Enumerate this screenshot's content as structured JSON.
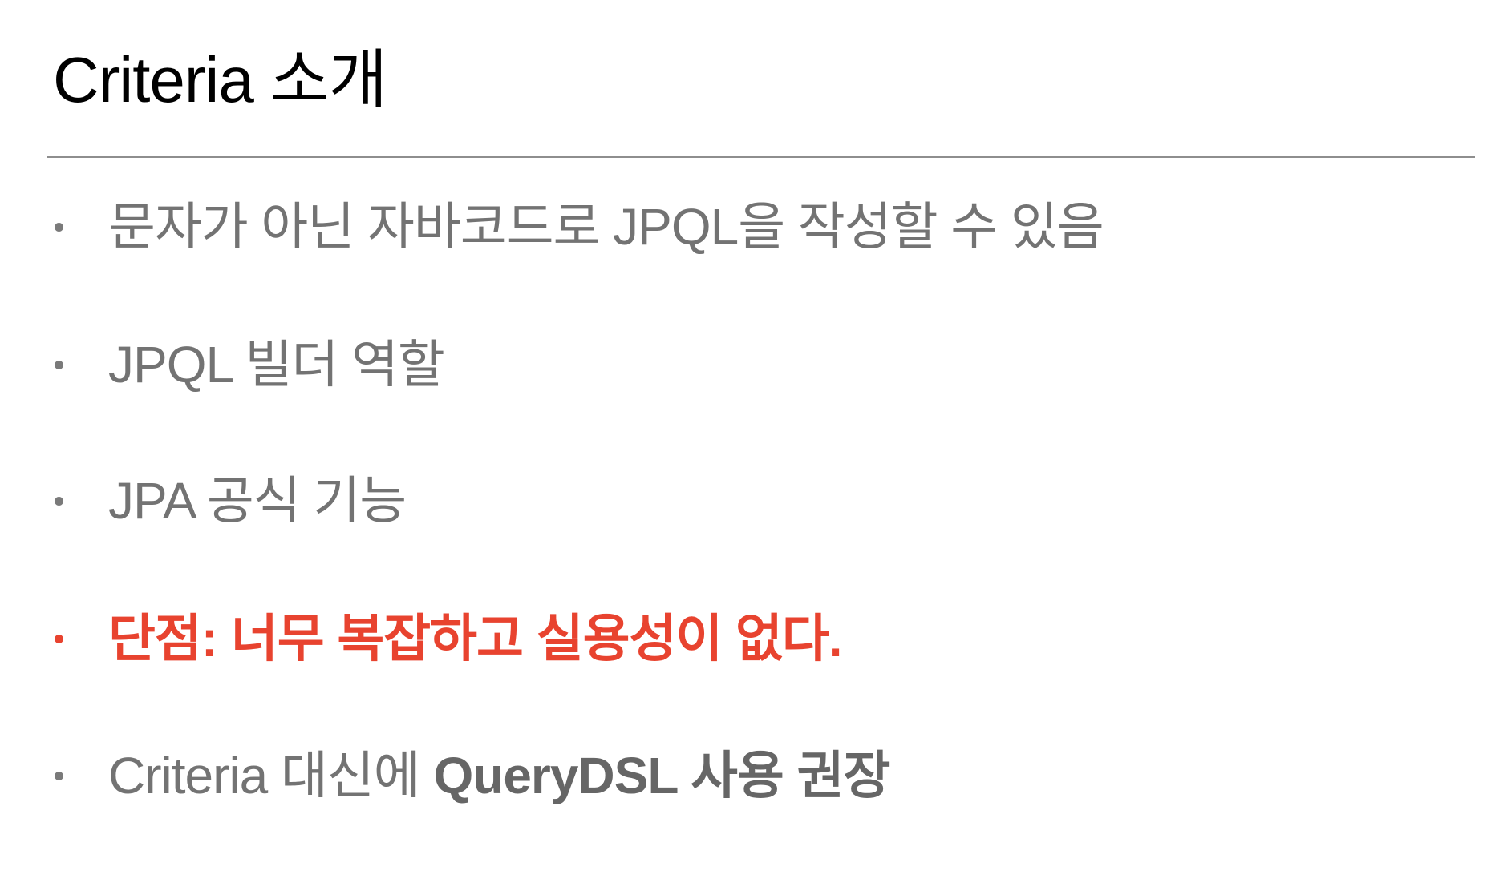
{
  "slide": {
    "title": "Criteria 소개"
  },
  "bullets": [
    {
      "text": "문자가 아닌 자바코드로 JPQL을 작성할 수 있음"
    },
    {
      "text": "JPQL 빌더 역할"
    },
    {
      "text": "JPA 공식 기능"
    },
    {
      "text": "단점: 너무 복잡하고 실용성이 없다."
    },
    {
      "text_prefix": "Criteria 대신에 ",
      "text_bold": "QueryDSL 사용 권장"
    }
  ],
  "colors": {
    "title": "#000000",
    "body_text": "#737373",
    "highlight": "#e8432f",
    "rule": "#8e8e8e",
    "background": "#ffffff"
  }
}
